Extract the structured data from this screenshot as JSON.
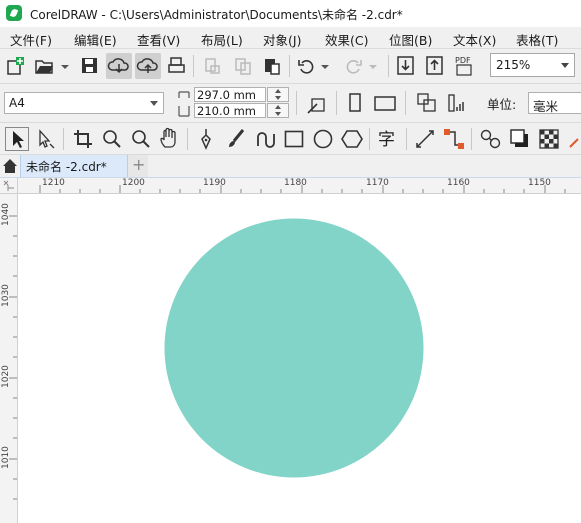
{
  "window": {
    "title": "CorelDRAW - C:\\Users\\Administrator\\Documents\\未命名 -2.cdr*"
  },
  "menu": {
    "items": [
      "文件(F)",
      "编辑(E)",
      "查看(V)",
      "布局(L)",
      "对象(J)",
      "效果(C)",
      "位图(B)",
      "文本(X)",
      "表格(T)"
    ]
  },
  "toolbar": {
    "zoom": "215%"
  },
  "property_bar": {
    "page_size": "A4",
    "width": "297.0 mm",
    "height": "210.0 mm",
    "unit_label": "单位:",
    "unit_value": "毫米"
  },
  "tabs": {
    "document": "未命名 -2.cdr*",
    "add": "+"
  },
  "rulers": {
    "horizontal": [
      "1210",
      "1200",
      "1190",
      "1180",
      "1170",
      "1160",
      "1150"
    ],
    "vertical": [
      "1040",
      "1030",
      "1020",
      "1010"
    ]
  },
  "shape": {
    "type": "circle",
    "fill": "#83d4c8"
  },
  "colors": {
    "menu_bg": "#f0f0f0",
    "tab_active": "#dbe9fa",
    "accent_logo": "#1fa84f"
  }
}
